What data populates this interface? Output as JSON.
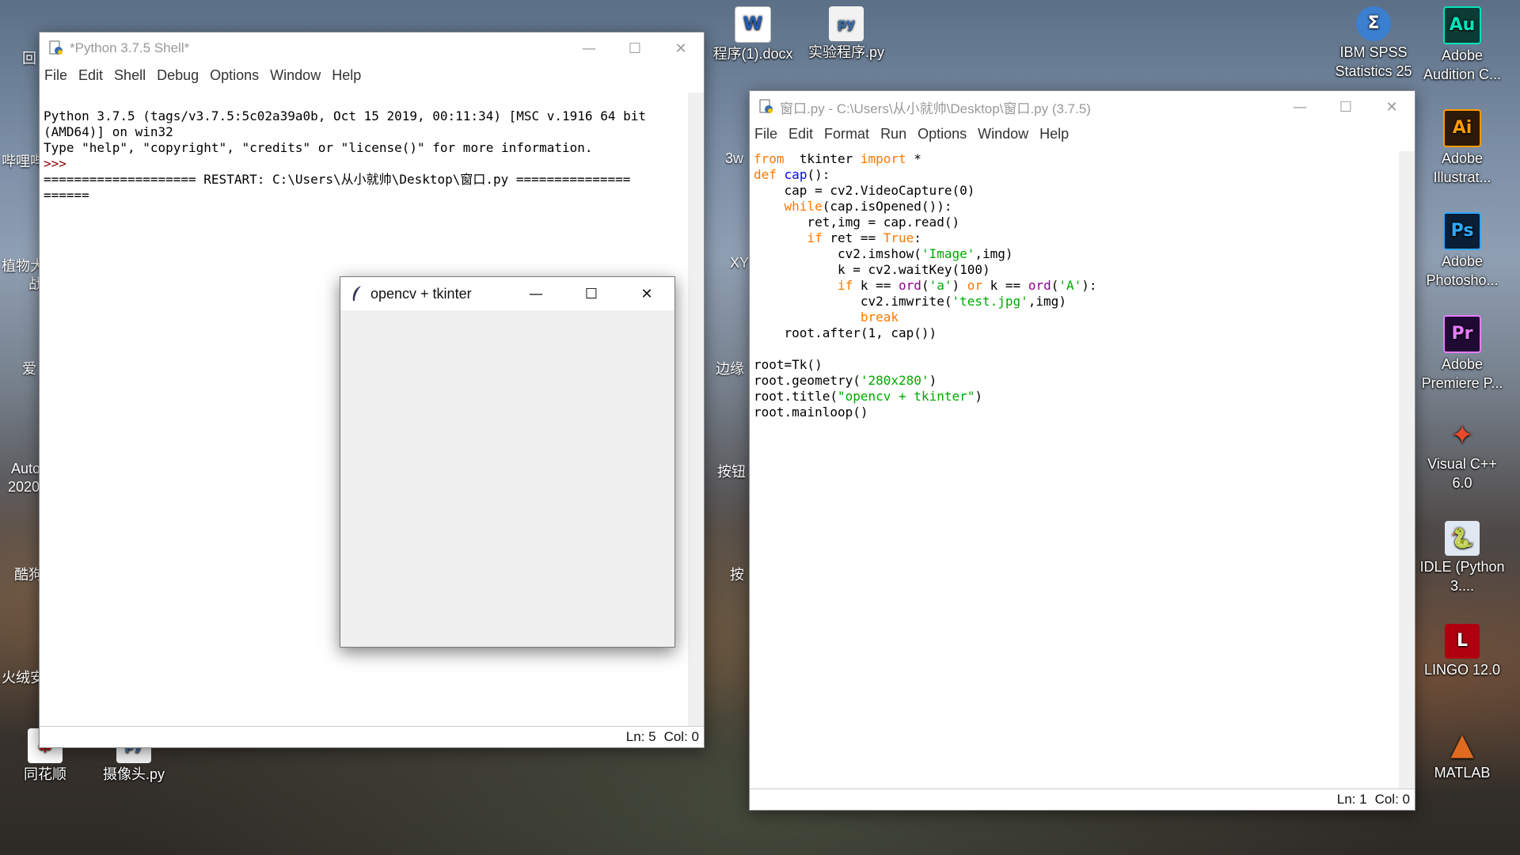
{
  "desktop": {
    "right_icons": [
      {
        "label": "IBM SPSS Statistics 25",
        "icon": "spss-icon",
        "glyph": "Σ",
        "color": "#3b7fd0"
      },
      {
        "label": "Adobe Audition C...",
        "icon": "audition-icon",
        "glyph": "Au",
        "color": "#0b3b34"
      },
      {
        "label": "Adobe Illustrat...",
        "icon": "illustrator-icon",
        "glyph": "Ai",
        "color": "#2d1a0a"
      },
      {
        "label": "Adobe Photosho...",
        "icon": "photoshop-icon",
        "glyph": "Ps",
        "color": "#0a1f36"
      },
      {
        "label": "Adobe Premiere P...",
        "icon": "premiere-icon",
        "glyph": "Pr",
        "color": "#1f0a33"
      },
      {
        "label": "Visual C++ 6.0",
        "icon": "visual-cpp-icon",
        "glyph": "✦",
        "color": "#c04020"
      },
      {
        "label": "IDLE (Python 3....",
        "icon": "idle-icon",
        "glyph": "🐍",
        "color": "#dfe7f2"
      },
      {
        "label": "LINGO 12.0",
        "icon": "lingo-icon",
        "glyph": "L",
        "color": "#b00010"
      },
      {
        "label": "MATLAB",
        "icon": "matlab-icon",
        "glyph": "▲",
        "color": "#e06a20"
      }
    ],
    "top_icons": [
      {
        "label": "程序(1).docx",
        "icon": "word-doc-icon",
        "glyph": "W"
      },
      {
        "label": "实验程序.py",
        "icon": "python-file-icon",
        "glyph": "py"
      }
    ],
    "bottom_icons": [
      {
        "label": "同花顺",
        "icon": "tonghuashun-icon"
      },
      {
        "label": "摄像头.py",
        "icon": "python-file-icon"
      }
    ],
    "left_fragments": [
      "回",
      "哔哩哔",
      "植物大",
      "战",
      "爱",
      "Auto",
      "2020",
      "酷狗",
      "火绒安"
    ],
    "mid_fragments": [
      "3w",
      "XY",
      "边缘",
      "按钮",
      "按"
    ]
  },
  "shell": {
    "title": "*Python 3.7.5 Shell*",
    "menu": [
      "File",
      "Edit",
      "Shell",
      "Debug",
      "Options",
      "Window",
      "Help"
    ],
    "lines": [
      "Python 3.7.5 (tags/v3.7.5:5c02a39a0b, Oct 15 2019, 00:11:34) [MSC v.1916 64 bit",
      "(AMD64)] on win32",
      "Type \"help\", \"copyright\", \"credits\" or \"license()\" for more information.",
      ">>> ",
      "==================== RESTART: C:\\Users\\从小就帅\\Desktop\\窗口.py ===============",
      "======"
    ],
    "status_ln": "Ln: 5",
    "status_col": "Col: 0"
  },
  "editor": {
    "title": "窗口.py - C:\\Users\\从小就帅\\Desktop\\窗口.py (3.7.5)",
    "menu": [
      "File",
      "Edit",
      "Format",
      "Run",
      "Options",
      "Window",
      "Help"
    ],
    "status_ln": "Ln: 1",
    "status_col": "Col: 0"
  },
  "tk_window": {
    "title": "opencv + tkinter"
  }
}
